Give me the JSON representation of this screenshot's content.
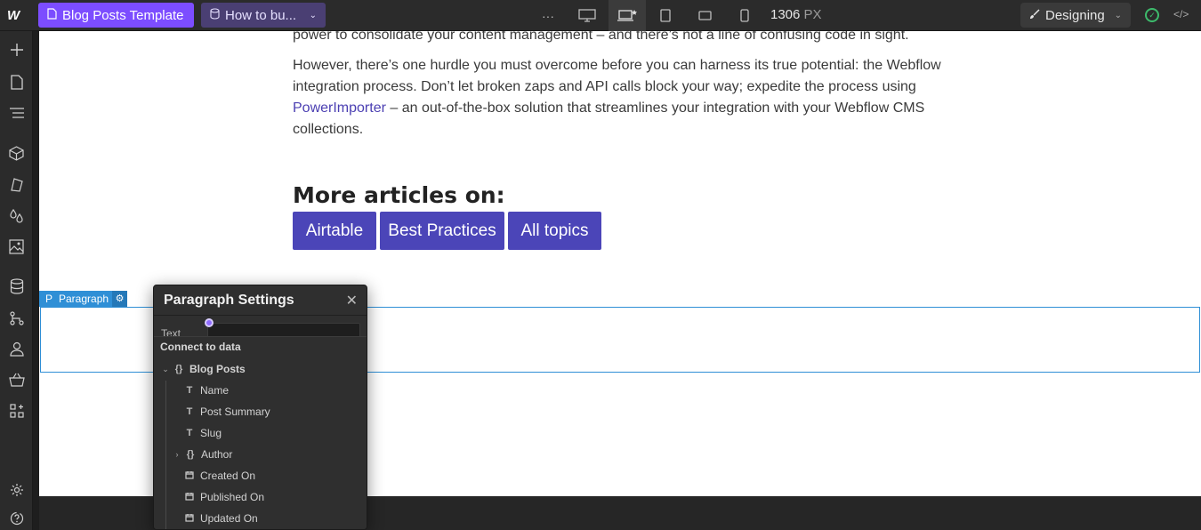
{
  "topbar": {
    "logo": "W",
    "page_label": "Blog Posts Template",
    "collection_item_label": "How to bu...",
    "more_label": "···",
    "breakpoint_width": "1306",
    "breakpoint_unit": "PX",
    "mode_label": "Designing"
  },
  "sidebar": {
    "icons": [
      "add-icon",
      "pages-icon",
      "navigator-icon",
      "components-icon",
      "styles-icon",
      "variables-icon",
      "assets-icon",
      "cms-icon",
      "logic-icon",
      "users-icon",
      "ecommerce-icon",
      "apps-icon",
      "settings-icon",
      "help-icon"
    ]
  },
  "canvas": {
    "partial_line": "power to consolidate your content management – and there’s not a line of confusing code in sight.",
    "paragraph_before_link": "However, there’s one hurdle you must overcome before you can harness its true potential: the Webflow integration process. Don’t let broken zaps and API calls block your way; expedite the process using ",
    "link_text": "PowerImporter",
    "paragraph_after_link": " – an out-of-the-box solution that streamlines your integration with your Webflow CMS collections.",
    "more_heading": "More articles on:",
    "tags": [
      "Airtable",
      "Best Practices",
      "All topics"
    ],
    "selected_label": "Paragraph",
    "selected_prefix": "P"
  },
  "panel": {
    "title": "Paragraph Settings",
    "text_label": "Text",
    "connect_heading": "Connect to data",
    "collection": "Blog Posts",
    "fields": [
      {
        "icon": "T",
        "label": "Name"
      },
      {
        "icon": "T",
        "label": "Post Summary"
      },
      {
        "icon": "T",
        "label": "Slug"
      },
      {
        "icon": "{}",
        "label": "Author"
      },
      {
        "icon": "cal",
        "label": "Created On"
      },
      {
        "icon": "cal",
        "label": "Published On"
      },
      {
        "icon": "cal",
        "label": "Updated On"
      }
    ]
  },
  "colors": {
    "accent": "#7c4dff",
    "selection": "#2f8fd6",
    "tag_bg": "#4b45b8",
    "link": "#4b3fb2"
  }
}
